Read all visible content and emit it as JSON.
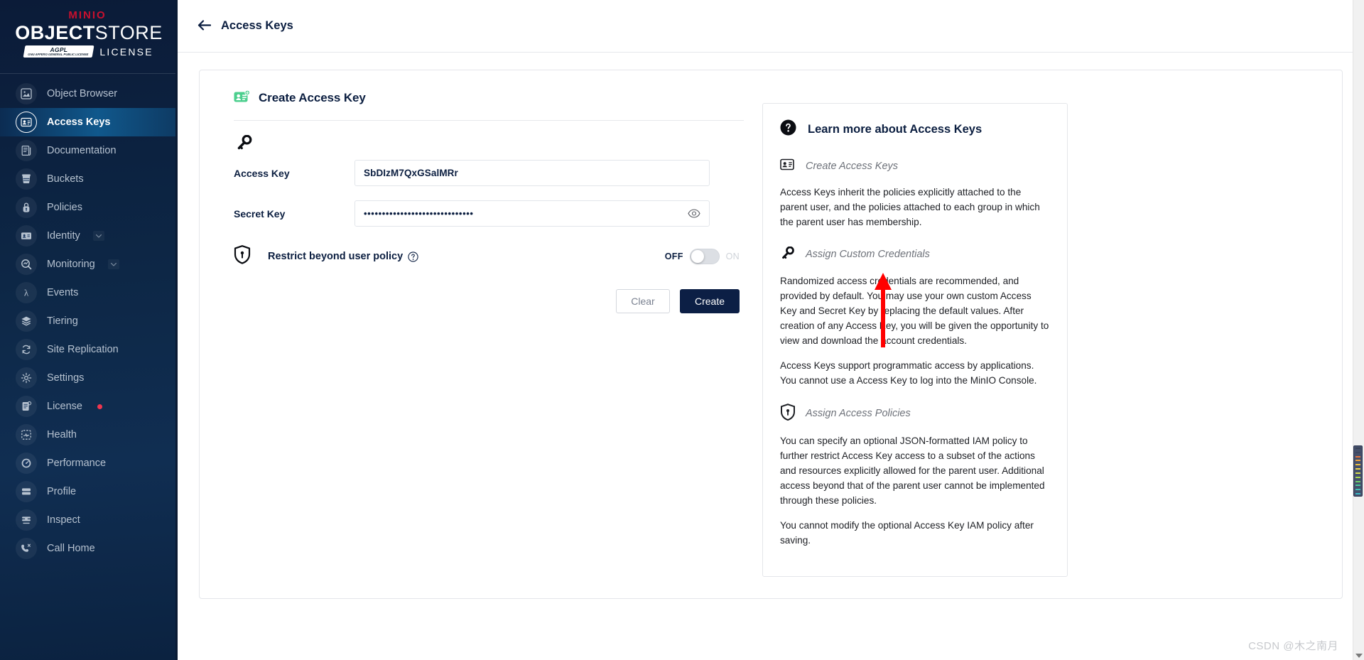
{
  "brand": {
    "minio": "MINIO",
    "object": "OBJECT",
    "store": "STORE",
    "license_badge": "AGPL",
    "license_badge_sub": "GNU AFFERO GENERAL PUBLIC LICENSE",
    "license_word": "LICENSE"
  },
  "sidebar": {
    "items": [
      {
        "label": "Object Browser",
        "icon": "object-browser-icon",
        "active": false,
        "chevron": false,
        "dot": false
      },
      {
        "label": "Access Keys",
        "icon": "access-keys-icon",
        "active": true,
        "chevron": false,
        "dot": false
      },
      {
        "label": "Documentation",
        "icon": "documentation-icon",
        "active": false,
        "chevron": false,
        "dot": false
      },
      {
        "label": "Buckets",
        "icon": "bucket-icon",
        "active": false,
        "chevron": false,
        "dot": false
      },
      {
        "label": "Policies",
        "icon": "policy-lock-icon",
        "active": false,
        "chevron": false,
        "dot": false
      },
      {
        "label": "Identity",
        "icon": "identity-card-icon",
        "active": false,
        "chevron": true,
        "dot": false
      },
      {
        "label": "Monitoring",
        "icon": "monitoring-search-icon",
        "active": false,
        "chevron": true,
        "dot": false
      },
      {
        "label": "Events",
        "icon": "lambda-icon",
        "active": false,
        "chevron": false,
        "dot": false
      },
      {
        "label": "Tiering",
        "icon": "layers-icon",
        "active": false,
        "chevron": false,
        "dot": false
      },
      {
        "label": "Site Replication",
        "icon": "replication-sync-icon",
        "active": false,
        "chevron": false,
        "dot": false
      },
      {
        "label": "Settings",
        "icon": "gear-icon",
        "active": false,
        "chevron": false,
        "dot": false
      },
      {
        "label": "License",
        "icon": "license-doc-icon",
        "active": false,
        "chevron": false,
        "dot": true
      },
      {
        "label": "Health",
        "icon": "health-icon",
        "active": false,
        "chevron": false,
        "dot": false
      },
      {
        "label": "Performance",
        "icon": "performance-gauge-icon",
        "active": false,
        "chevron": false,
        "dot": false
      },
      {
        "label": "Profile",
        "icon": "profile-server-icon",
        "active": false,
        "chevron": false,
        "dot": false
      },
      {
        "label": "Inspect",
        "icon": "inspect-icon",
        "active": false,
        "chevron": false,
        "dot": false
      },
      {
        "label": "Call Home",
        "icon": "call-home-phone-icon",
        "active": false,
        "chevron": false,
        "dot": false
      }
    ]
  },
  "header": {
    "back_icon": "back-arrow-icon",
    "title": "Access Keys"
  },
  "form": {
    "card_icon": "create-access-key-icon",
    "card_title": "Create Access Key",
    "key_icon": "key-icon",
    "access_key_label": "Access Key",
    "access_key_value": "SbDIzM7QxGSalMRr",
    "access_key_placeholder": "Access Key",
    "secret_key_label": "Secret Key",
    "secret_key_masked": "••••••••••••••••••••••••••••••",
    "eye_icon": "eye-icon",
    "restrict_icon": "shield-key-icon",
    "restrict_label": "Restrict beyond user policy",
    "restrict_help_icon": "help-circle-icon",
    "toggle_off_label": "OFF",
    "toggle_on_label": "ON",
    "toggle_state": "off",
    "clear_label": "Clear",
    "create_label": "Create"
  },
  "help": {
    "head_icon": "help-circle-filled-icon",
    "title": "Learn more about Access Keys",
    "sections": [
      {
        "icon": "create-access-keys-icon",
        "title": "Create Access Keys",
        "paragraphs": [
          "Access Keys inherit the policies explicitly attached to the parent user, and the policies attached to each group in which the parent user has membership."
        ]
      },
      {
        "icon": "key-icon",
        "title": "Assign Custom Credentials",
        "paragraphs": [
          "Randomized access credentials are recommended, and provided by default. You may use your own custom Access Key and Secret Key by replacing the default values. After creation of any Access Key, you will be given the opportunity to view and download the account credentials.",
          "Access Keys support programmatic access by applications. You cannot use a Access Key to log into the MinIO Console."
        ]
      },
      {
        "icon": "shield-key-icon",
        "title": "Assign Access Policies",
        "paragraphs": [
          "You can specify an optional JSON-formatted IAM policy to further restrict Access Key access to a subset of the actions and resources explicitly allowed for the parent user. Additional access beyond that of the parent user cannot be implemented through these policies.",
          "You cannot modify the optional Access Key IAM policy after saving."
        ]
      }
    ]
  },
  "annotation": {
    "arrow_icon": "red-up-arrow-annotation"
  },
  "watermark": "CSDN @木之南月",
  "colors": {
    "sidebar_dark": "#0b1b38",
    "active_nav": "#10588c",
    "accent_red": "#c8102e",
    "badge_red": "#f0364f",
    "create_btn": "#0c1f45",
    "card_icon_green": "#4ccf8e",
    "annotation_red": "#ff0000"
  }
}
